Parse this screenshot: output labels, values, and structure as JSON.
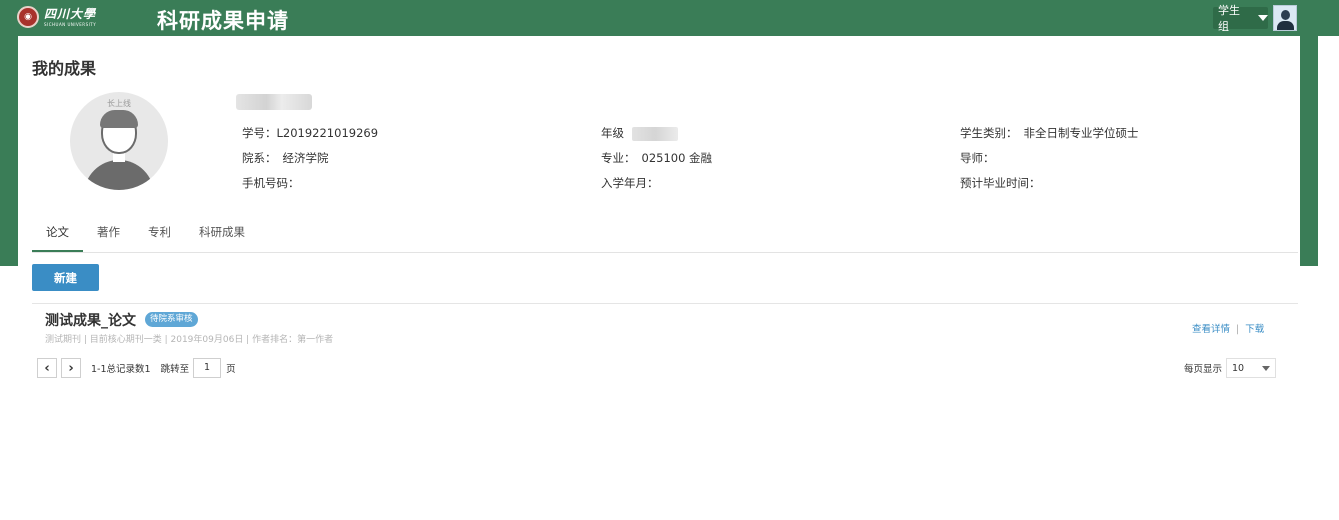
{
  "header": {
    "logo_cn": "四川大學",
    "logo_en": "SICHUAN UNIVERSITY",
    "app_title": "科研成果申请",
    "role_label": "学生组",
    "brand_color": "#3a7d57"
  },
  "page": {
    "title": "我的成果"
  },
  "profile": {
    "avatar_watermark": "长上线",
    "student_id_label": "学号：",
    "student_id": "L2019221019269",
    "grade_label": "年级",
    "student_type_label": "学生类别：",
    "student_type": "非全日制专业学位硕士",
    "dept_label": "院系：",
    "dept": "经济学院",
    "major_label": "专业：",
    "major": "025100 金融",
    "advisor_label": "导师：",
    "phone_label": "手机号码：",
    "enroll_label": "入学年月：",
    "grad_label": "预计毕业时间："
  },
  "tabs": [
    {
      "label": "论文",
      "active": true
    },
    {
      "label": "著作",
      "active": false
    },
    {
      "label": "专利",
      "active": false
    },
    {
      "label": "科研成果",
      "active": false
    }
  ],
  "toolbar": {
    "new_label": "新建"
  },
  "records": [
    {
      "title": "测试成果_论文",
      "status": "待院系审核",
      "meta": "测试期刊 | 目前核心期刊一类 | 2019年09月06日 | 作者排名：第一作者",
      "view_label": "查看详情",
      "download_label": "下载"
    }
  ],
  "pager": {
    "prev_icon": "chevron-left-icon",
    "next_icon": "chevron-right-icon",
    "summary": "1-1总记录数1",
    "jump_label": "跳转至",
    "page": "1",
    "page_unit": "页",
    "per_page_label": "每页显示",
    "per_page": "10"
  }
}
